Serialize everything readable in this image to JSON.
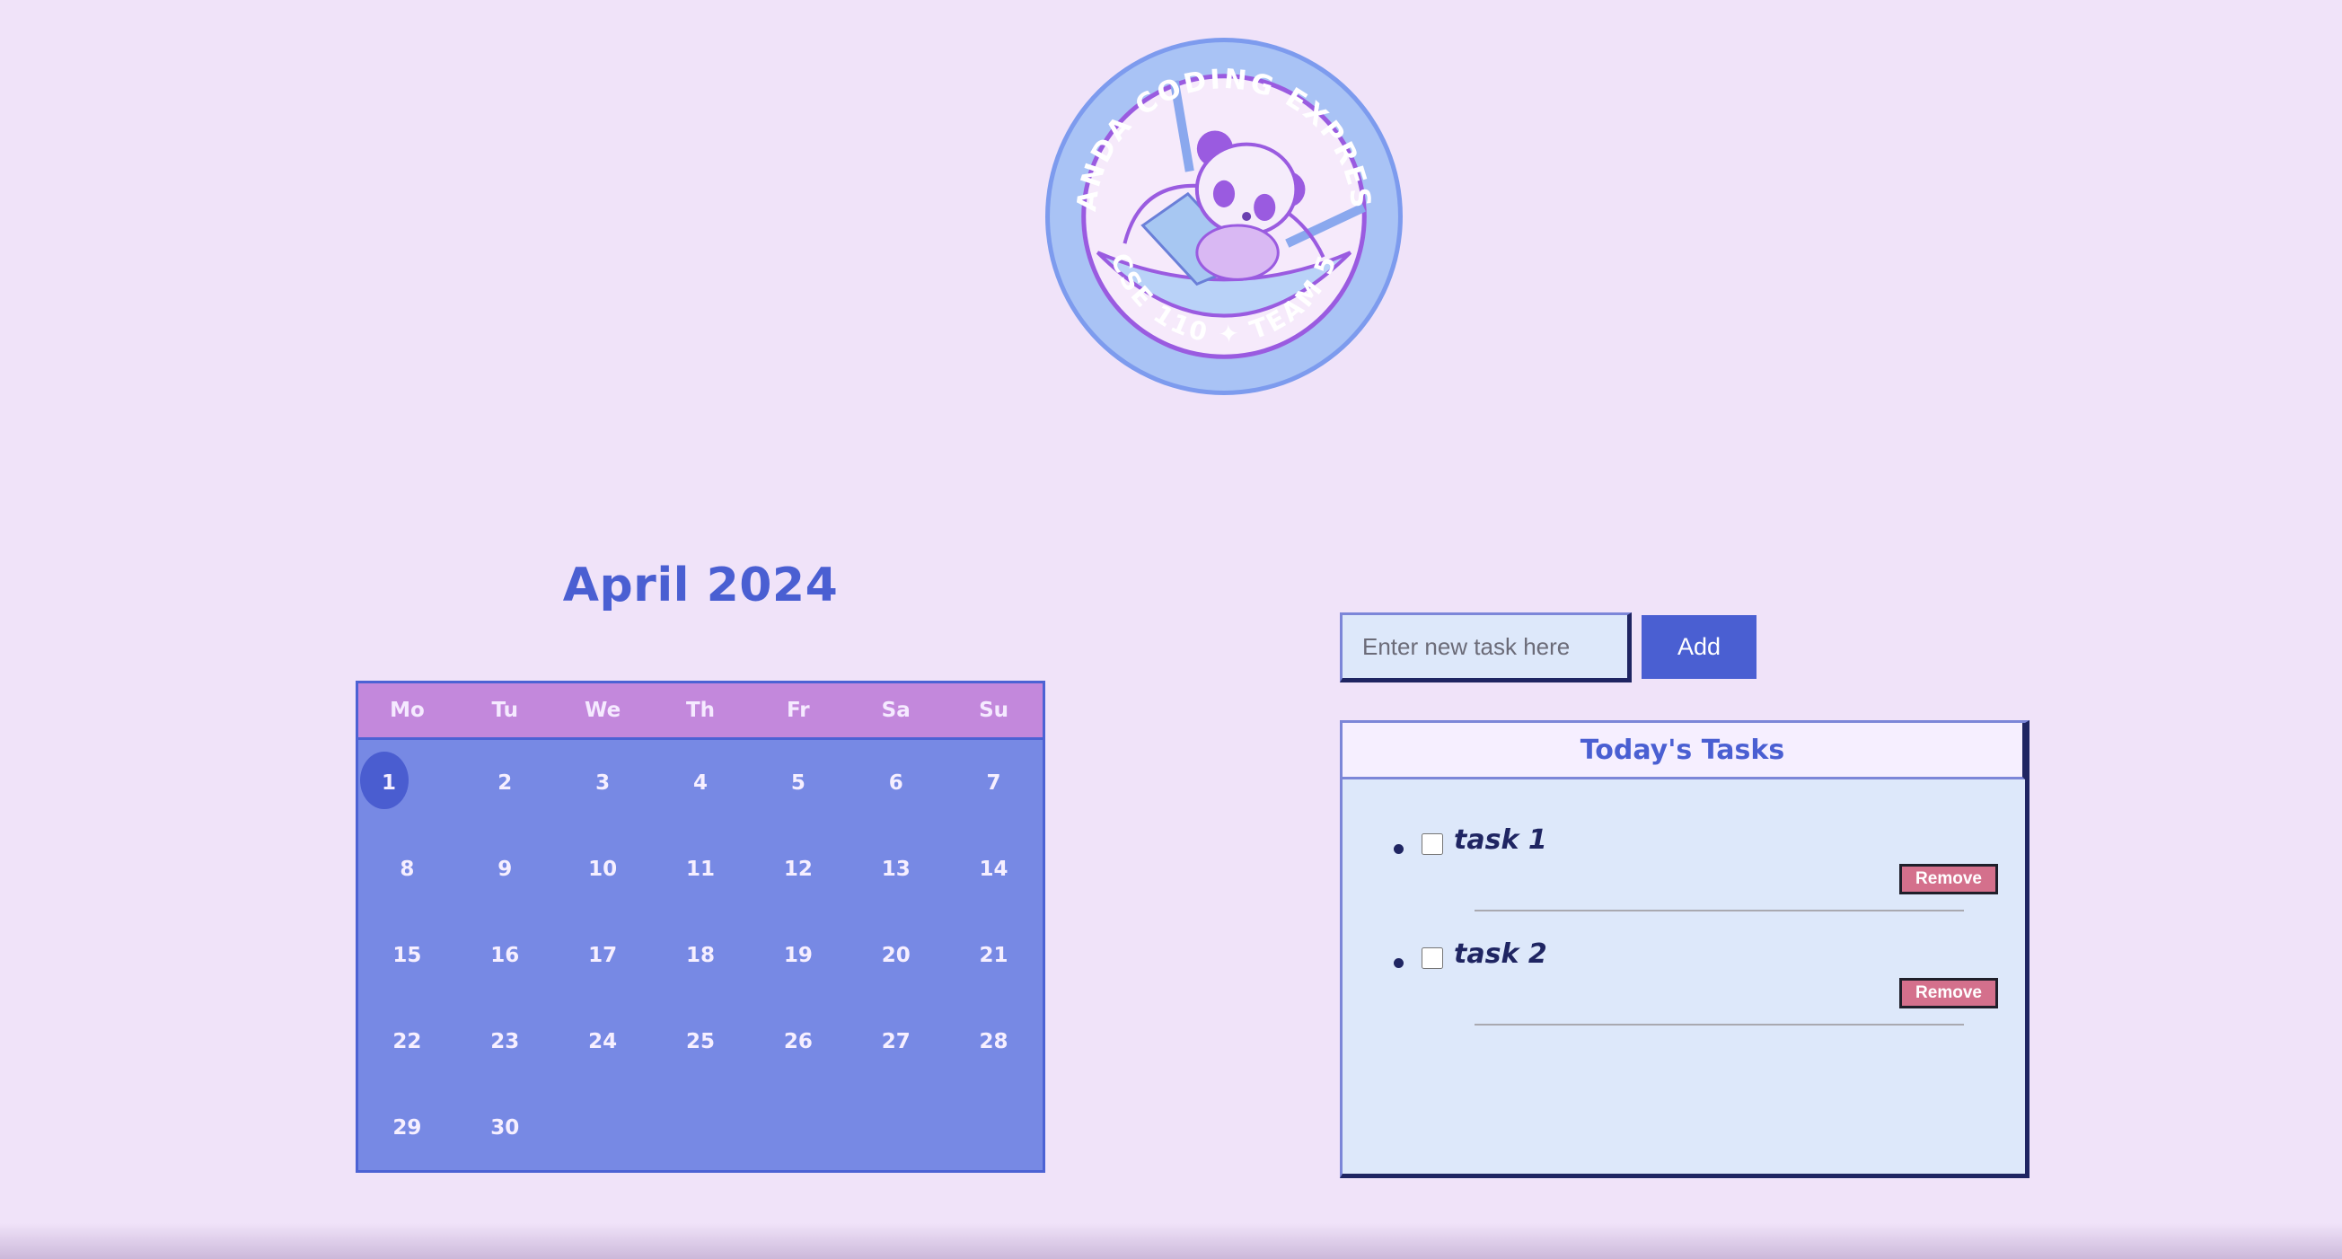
{
  "logo": {
    "top_text": "PANDA CODING EXPRESS",
    "bottom_text": "CSE 110 ✦ TEAM 5"
  },
  "calendar": {
    "title": "April 2024",
    "weekdays": [
      "Mo",
      "Tu",
      "We",
      "Th",
      "Fr",
      "Sa",
      "Su"
    ],
    "days": [
      "1",
      "2",
      "3",
      "4",
      "5",
      "6",
      "7",
      "8",
      "9",
      "10",
      "11",
      "12",
      "13",
      "14",
      "15",
      "16",
      "17",
      "18",
      "19",
      "20",
      "21",
      "22",
      "23",
      "24",
      "25",
      "26",
      "27",
      "28",
      "29",
      "30"
    ],
    "today": "1"
  },
  "task_input": {
    "placeholder": "Enter new task here",
    "value": ""
  },
  "add_button": {
    "label": "Add"
  },
  "tasks_panel": {
    "title": "Today's Tasks",
    "tasks": [
      {
        "label": "task 1",
        "checked": false,
        "remove_label": "Remove"
      },
      {
        "label": "task 2",
        "checked": false,
        "remove_label": "Remove"
      }
    ]
  },
  "colors": {
    "background": "#f0e3f9",
    "accent": "#4a5fd2",
    "calendar_body": "#7789e4",
    "calendar_header": "#c388dc",
    "panel_bg": "#dde8fa",
    "remove_button": "#d4708c"
  }
}
